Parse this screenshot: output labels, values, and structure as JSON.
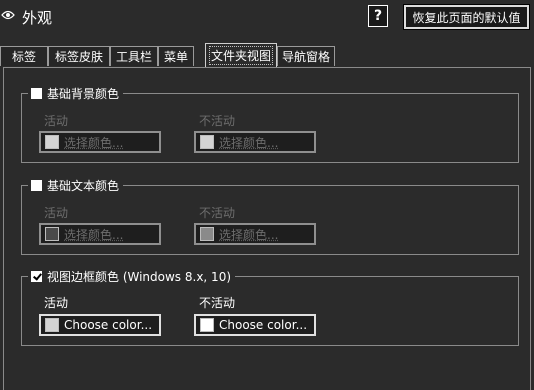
{
  "header": {
    "title": "外观",
    "help_label": "?",
    "restore_label": "恢复此页面的默认值"
  },
  "tabs": [
    {
      "label": "标签"
    },
    {
      "label": "标签皮肤"
    },
    {
      "label": "工具栏"
    },
    {
      "label": "菜单"
    },
    {
      "label": "文件夹视图",
      "active": true
    },
    {
      "label": "导航窗格"
    }
  ],
  "groups": {
    "background": {
      "label": "基础背景颜色",
      "checked": false,
      "active_label": "活动",
      "inactive_label": "不活动",
      "active_button": "选择颜色...",
      "inactive_button": "选择颜色...",
      "active_swatch": "#d4d4d4",
      "inactive_swatch": "#d4d4d4",
      "enabled": false
    },
    "text": {
      "label": "基础文本颜色",
      "checked": false,
      "active_label": "活动",
      "inactive_label": "不活动",
      "active_button": "选择颜色...",
      "inactive_button": "选择颜色...",
      "active_swatch": "#4a4a4a",
      "inactive_swatch": "#8a8a8a",
      "enabled": false
    },
    "border": {
      "label": "视图边框颜色 (Windows 8.x, 10)",
      "checked": true,
      "active_label": "活动",
      "inactive_label": "不活动",
      "active_button": "Choose color...",
      "inactive_button": "Choose color...",
      "active_swatch": "#d4d4d4",
      "inactive_swatch": "#ffffff",
      "enabled": true
    }
  },
  "colors": {
    "background": "#2b2b2b",
    "border": "#8a8a8a",
    "disabled_text": "#6d6d6d"
  }
}
